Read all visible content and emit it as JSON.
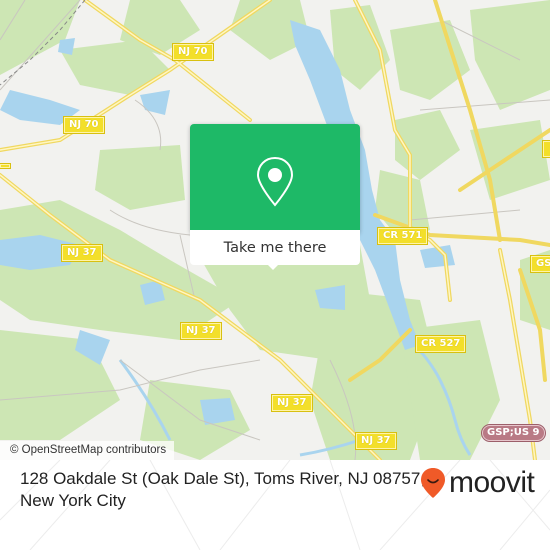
{
  "map": {
    "road_labels": [
      {
        "id": "nj70-top",
        "text": "NJ 70",
        "type": "state"
      },
      {
        "id": "nj70-left",
        "text": "NJ 70",
        "type": "state"
      },
      {
        "id": "nj37-a",
        "text": "NJ 37",
        "type": "state"
      },
      {
        "id": "nj37-b",
        "text": "NJ 37",
        "type": "state"
      },
      {
        "id": "nj37-c",
        "text": "NJ 37",
        "type": "state"
      },
      {
        "id": "nj37-d",
        "text": "NJ 37",
        "type": "state"
      },
      {
        "id": "cr571",
        "text": "CR 571",
        "type": "county"
      },
      {
        "id": "cr527",
        "text": "CR 527",
        "type": "county"
      },
      {
        "id": "gsp-top",
        "text": "GSP",
        "type": "parkway"
      },
      {
        "id": "gsp-us9",
        "text": "GSP;US 9",
        "type": "parkway"
      }
    ],
    "attribution": "© OpenStreetMap contributors",
    "colors": {
      "land": "#f2f2ef",
      "park": "#cde6b4",
      "water": "#a9d4ee",
      "road": "#f5e27a"
    }
  },
  "popup": {
    "icon": "map-pin-icon",
    "button_label": "Take me there",
    "color": "#1eb967"
  },
  "footer": {
    "address_line1": "128 Oakdale St (Oak Dale St), Toms River, NJ 08757,",
    "address_line2": "New York City",
    "brand": "moovit",
    "brand_color": "#f05a28"
  }
}
